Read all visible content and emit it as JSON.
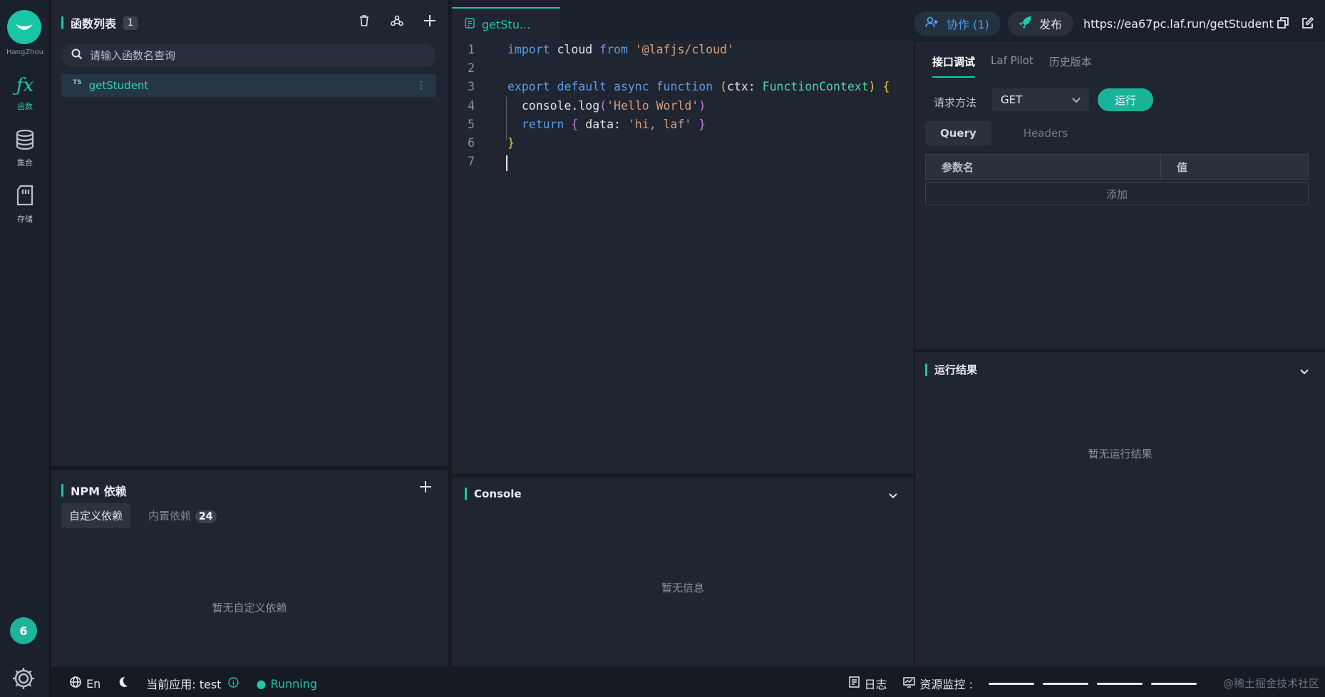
{
  "rail": {
    "region": "HangZhou",
    "items": [
      {
        "icon": "function-icon",
        "label": "函数"
      },
      {
        "icon": "database-icon",
        "label": "集合"
      },
      {
        "icon": "storage-icon",
        "label": "存储"
      }
    ],
    "badge": "6"
  },
  "functions": {
    "title": "函数列表",
    "count": "1",
    "search_placeholder": "请输入函数名查询",
    "items": [
      {
        "lang": "TS",
        "name": "getStudent"
      }
    ]
  },
  "npm": {
    "title": "NPM 依赖",
    "tabs": [
      {
        "label": "自定义依赖"
      },
      {
        "label": "内置依赖",
        "count": "24"
      }
    ],
    "empty": "暂无自定义依赖"
  },
  "editor": {
    "tab_label": "getStu...",
    "line_numbers": [
      "1",
      "2",
      "3",
      "4",
      "5",
      "6",
      "7"
    ]
  },
  "console": {
    "title": "Console",
    "empty": "暂无信息"
  },
  "topbar": {
    "collab_label": "协作 (1)",
    "publish_label": "发布",
    "url": "https://ea67pc.laf.run/getStudent"
  },
  "debug": {
    "tabs": [
      "接口调试",
      "Laf Pilot",
      "历史版本"
    ],
    "method_label": "请求方法",
    "method_value": "GET",
    "run_label": "运行",
    "query_tabs": [
      "Query",
      "Headers"
    ],
    "param_col": "参数名",
    "value_col": "值",
    "add_label": "添加"
  },
  "result": {
    "title": "运行结果",
    "empty": "暂无运行结果"
  },
  "status": {
    "lang": "En",
    "app_label": "当前应用: test",
    "running": "Running",
    "logs": "日志",
    "monitor": "资源监控 :"
  },
  "watermark": "@稀土掘金技术社区",
  "colors": {
    "accent": "#19c6a6",
    "bg": "#151a23",
    "panel": "#1f2531",
    "link": "#4b9df3"
  }
}
